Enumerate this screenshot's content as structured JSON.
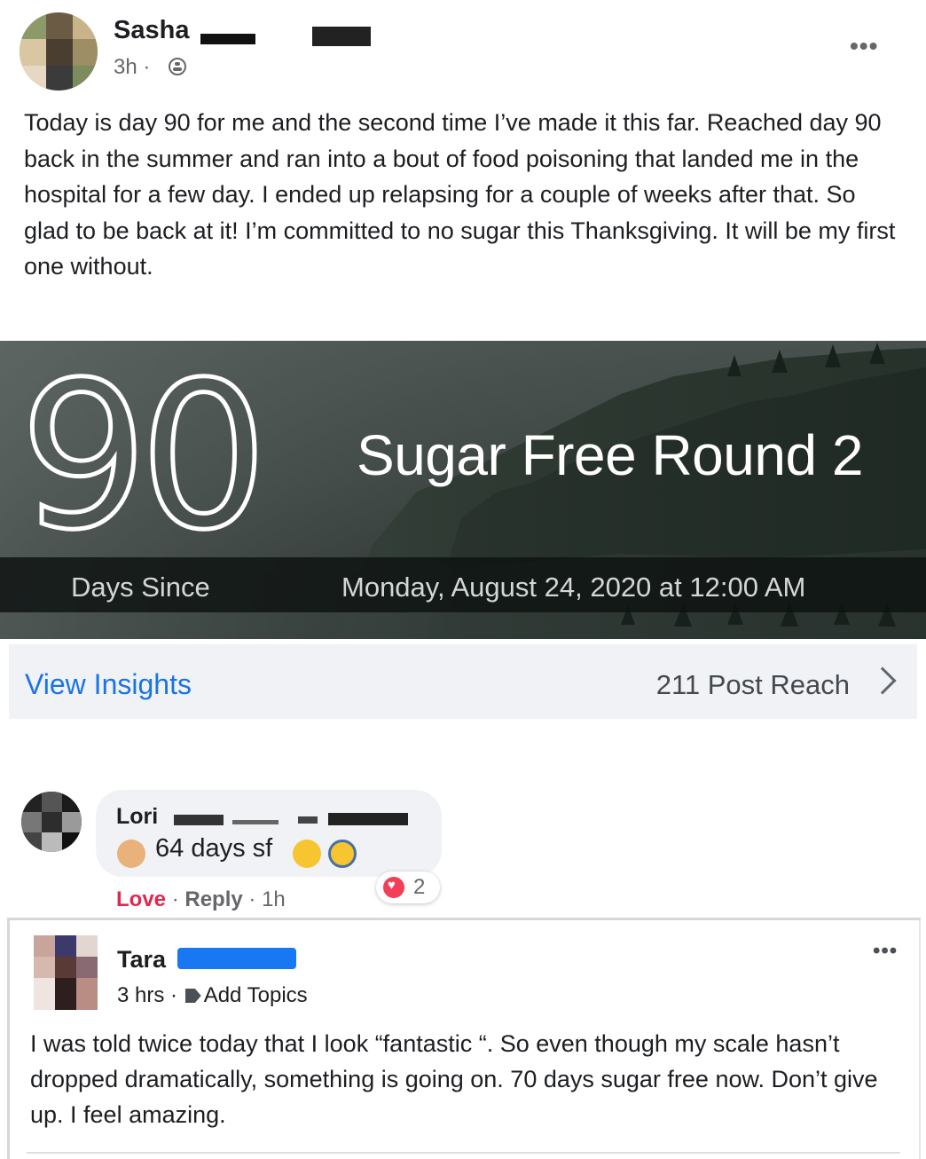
{
  "post": {
    "author": "Sasha",
    "time": "3h ·",
    "text": "Today is day 90 for me and the second time I’ve made it this far. Reached day 90 back in the summer and ran into a bout of food poisoning that landed me in the hospital for a few day. I ended up relapsing for a couple of weeks after that. So glad to be back at it! I’m committed to no sugar this Thanksgiving. It will be my first one without.",
    "more": "•••"
  },
  "counter": {
    "number": "90",
    "title": "Sugar Free Round 2",
    "since_label": "Days Since",
    "since_date": "Monday, August 24, 2020 at 12:00 AM"
  },
  "insights": {
    "link": "View Insights",
    "reach": "211 Post Reach"
  },
  "comment": {
    "author": "Lori",
    "text": "64 days sf",
    "love": "Love",
    "reply": "Reply",
    "time": "1h",
    "reaction_count": "2"
  },
  "second_post": {
    "author": "Tara",
    "time": "3 hrs ·",
    "topics": "Add Topics",
    "text": "I was told twice today that I look “fantastic “. So even though my scale hasn’t dropped dramatically, something is going on. 70 days sugar free now. Don’t give up. I feel amazing.",
    "more": "•••"
  },
  "colors": {
    "link_blue": "#1b74e4",
    "love_red": "#e0284f",
    "heart": "#f33e58"
  }
}
